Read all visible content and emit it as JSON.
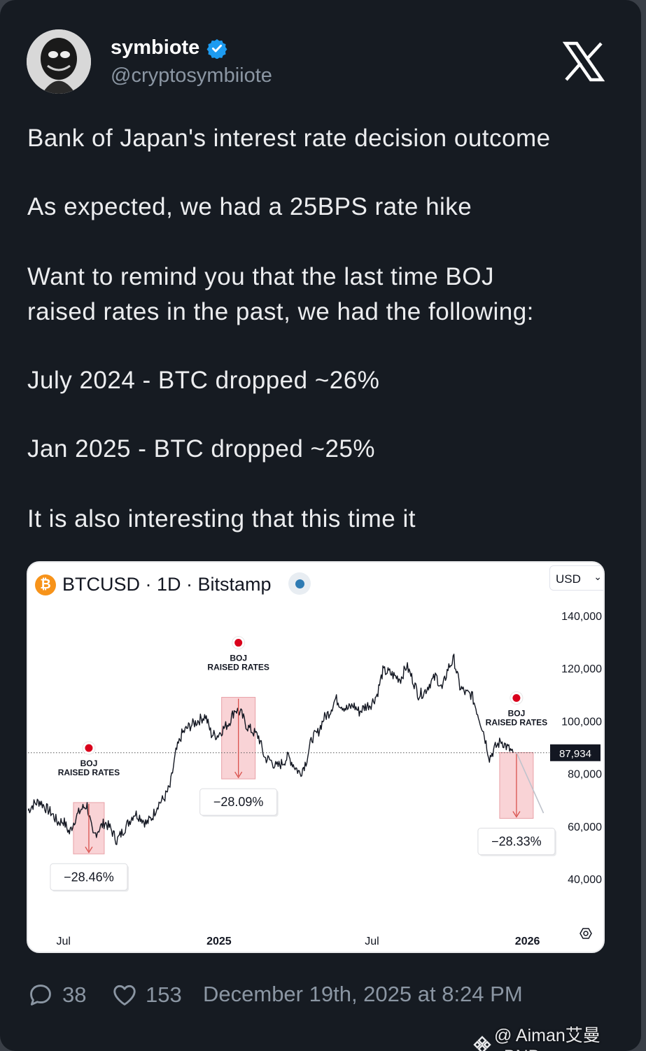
{
  "author": {
    "display_name": "symbiote",
    "handle": "@cryptosymbiiote"
  },
  "tweet": {
    "lines": [
      "Bank of Japan's interest rate decision outcome",
      "As expected, we had a 25BPS rate hike",
      "Want to remind you that the last time BOJ",
      "raised rates in the past, we had the following:",
      "July 2024 - BTC dropped ~26%",
      "Jan 2025 - BTC dropped ~25%",
      "It is also interesting that this time it"
    ]
  },
  "chart_header": {
    "symbol_badge": "₿",
    "title": "BTCUSD · 1D · Bitstamp",
    "currency": "USD"
  },
  "chart_data": {
    "type": "line",
    "symbol": "BTCUSD",
    "ylim": [
      30000,
      145000
    ],
    "y_ticks": [
      "140,000",
      "120,000",
      "100,000",
      "80,000",
      "60,000",
      "40,000"
    ],
    "y_tick_values": [
      140000,
      120000,
      100000,
      80000,
      60000,
      40000
    ],
    "x_ticks": [
      "Jul",
      "2025",
      "Jul",
      "2026"
    ],
    "last_price_label": "87,934",
    "last_price": 87934,
    "series": [
      {
        "x": [
          "2024-05-20",
          "2024-05-27",
          "2024-06-03",
          "2024-06-10",
          "2024-06-17",
          "2024-06-24",
          "2024-07-01",
          "2024-07-08",
          "2024-07-15",
          "2024-07-22",
          "2024-07-29",
          "2024-08-05",
          "2024-08-12",
          "2024-08-19",
          "2024-08-26",
          "2024-09-02",
          "2024-09-09",
          "2024-09-16",
          "2024-09-23",
          "2024-09-30",
          "2024-10-07",
          "2024-10-14",
          "2024-10-21",
          "2024-10-28",
          "2024-11-04",
          "2024-11-11",
          "2024-11-18",
          "2024-11-25",
          "2024-12-02",
          "2024-12-09",
          "2024-12-16",
          "2024-12-23",
          "2024-12-30",
          "2025-01-06",
          "2025-01-13",
          "2025-01-20",
          "2025-01-27",
          "2025-02-03",
          "2025-02-10",
          "2025-02-17",
          "2025-02-24",
          "2025-03-03",
          "2025-03-10",
          "2025-03-17",
          "2025-03-24",
          "2025-03-31",
          "2025-04-07",
          "2025-04-14",
          "2025-04-21",
          "2025-04-28",
          "2025-05-05",
          "2025-05-12",
          "2025-05-19",
          "2025-05-26",
          "2025-06-02",
          "2025-06-09",
          "2025-06-16",
          "2025-06-23",
          "2025-06-30",
          "2025-07-07",
          "2025-07-14",
          "2025-07-21",
          "2025-07-28",
          "2025-08-04",
          "2025-08-11",
          "2025-08-18",
          "2025-08-25",
          "2025-09-01",
          "2025-09-08",
          "2025-09-15",
          "2025-09-22",
          "2025-09-29",
          "2025-10-06",
          "2025-10-13",
          "2025-10-20",
          "2025-10-27",
          "2025-11-03",
          "2025-11-10",
          "2025-11-17",
          "2025-11-24",
          "2025-12-01",
          "2025-12-08",
          "2025-12-15"
        ],
        "values": [
          66000,
          68500,
          69500,
          67000,
          65000,
          61500,
          62000,
          57500,
          63000,
          66500,
          68000,
          56000,
          59000,
          61500,
          59000,
          54500,
          58000,
          61500,
          65000,
          63500,
          61000,
          63500,
          68500,
          70500,
          75000,
          88000,
          95000,
          97500,
          99000,
          100500,
          102000,
          95000,
          94500,
          97000,
          99500,
          104500,
          103000,
          98000,
          96000,
          94000,
          86000,
          85000,
          82500,
          84000,
          86500,
          83000,
          80000,
          84500,
          93500,
          95500,
          101000,
          103500,
          108500,
          106000,
          104500,
          106000,
          103500,
          105500,
          106500,
          110000,
          119000,
          118500,
          117000,
          116000,
          121000,
          116000,
          110000,
          111000,
          114500,
          117000,
          112000,
          120000,
          123500,
          113000,
          110500,
          110000,
          103000,
          96000,
          86000,
          90000,
          92500,
          90000,
          87934
        ]
      }
    ],
    "annotations": [
      {
        "text": "BOJ RAISED RATES",
        "date": "2024-07-31",
        "drawdown": "−28.46%",
        "from": 69000,
        "to": 49500
      },
      {
        "text": "BOJ RAISED RATES",
        "date": "2025-01-24",
        "drawdown": "−28.09%",
        "from": 109000,
        "to": 78000
      },
      {
        "text": "BOJ RAISED RATES",
        "date": "2025-12-19",
        "drawdown": "−28.33%",
        "from": 88000,
        "to": 63000
      }
    ],
    "projection": {
      "x": [
        "2025-12-19",
        "2026-01-20"
      ],
      "values": [
        88000,
        65000
      ]
    },
    "grid": false
  },
  "footer": {
    "replies": "38",
    "likes": "153",
    "date": "December 19th, 2025 at 8:24 PM"
  },
  "watermark": "@ Aiman艾曼_BNB",
  "colors": {
    "background": "#161b22",
    "verified": "#1d9bf0",
    "drop_fill": "#f9d3d6",
    "drop_line": "#d9534f",
    "boj_dot": "#d9001b"
  }
}
